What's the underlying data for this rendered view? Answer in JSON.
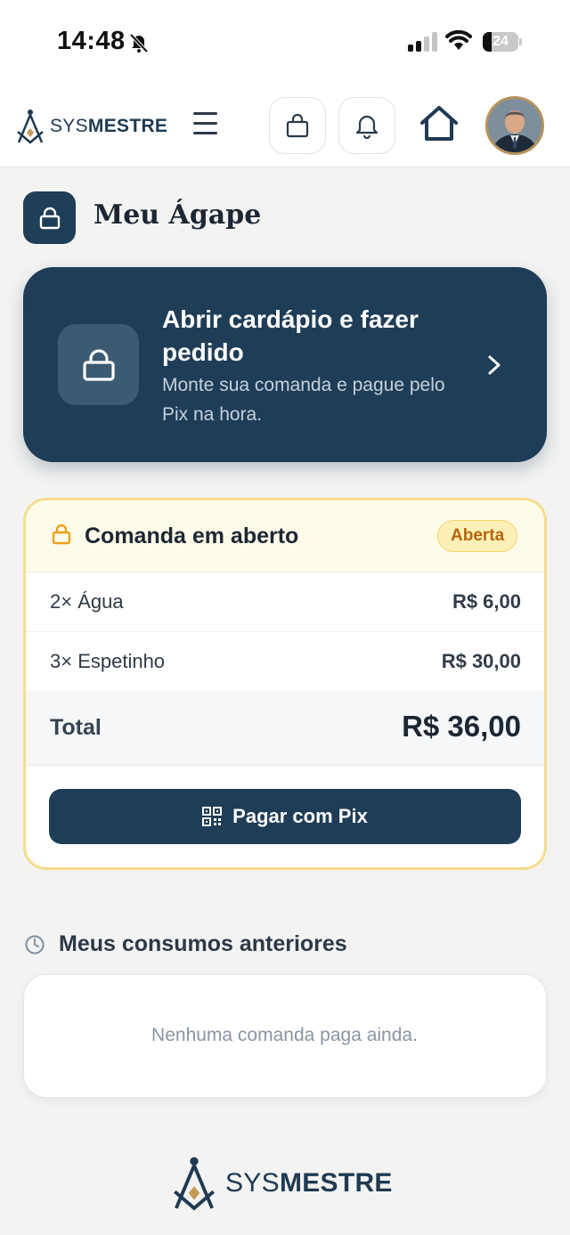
{
  "status_bar": {
    "time": "14:48",
    "battery_level": "24",
    "battery_fraction": 0.24,
    "icons": [
      "bell-slash-icon",
      "signal-icon",
      "wifi-icon",
      "battery-icon"
    ]
  },
  "header": {
    "logo_thin": "SYS",
    "logo_bold": "MESTRE",
    "icons": [
      "masonic-logo-icon",
      "hamburger-menu-icon",
      "shopping-bag-icon",
      "bell-icon",
      "home-icon"
    ]
  },
  "page": {
    "title": "Meu Ágape",
    "title_icon": "lock-icon"
  },
  "menu_card": {
    "title": "Abrir cardápio e fazer pedido",
    "subtitle": "Monte sua comanda e pague pelo Pix na hora.",
    "icon": "lock-icon",
    "chevron": "chevron-right-icon"
  },
  "order": {
    "title": "Comanda em aberto",
    "badge": "Aberta",
    "items": [
      {
        "name": "2× Água",
        "price": "R$ 6,00"
      },
      {
        "name": "3× Espetinho",
        "price": "R$ 30,00"
      }
    ],
    "total_label": "Total",
    "total_value": "R$ 36,00",
    "pay_button": "Pagar com Pix",
    "pay_icon": "qr-code-icon"
  },
  "history": {
    "title": "Meus consumos anteriores",
    "empty_text": "Nenhuma comanda paga ainda.",
    "icon": "clock-icon"
  },
  "footer": {
    "logo_thin": "SYS",
    "logo_bold": "MESTRE"
  },
  "colors": {
    "brand_navy": "#1f3d56",
    "accent_gold": "#b6925a",
    "badge_text": "#b5650b",
    "badge_bg": "#fdf0b6"
  }
}
